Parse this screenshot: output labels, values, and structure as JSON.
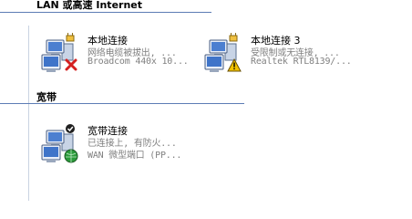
{
  "groups": {
    "lan_header": "LAN 或高速 Internet",
    "broadband_header": "宽带"
  },
  "connections": [
    {
      "name": "本地连接",
      "status": "网络电缆被拔出, ...",
      "device": "Broadcom 440x 10...",
      "overlay_icon": "red-x-icon"
    },
    {
      "name": "本地连接 3",
      "status": "受限制或无连接, ...",
      "device": "Realtek RTL8139/...",
      "overlay_icon": "warning-icon"
    },
    {
      "name": "宽带连接",
      "status": "已连接上, 有防火...",
      "device": "WAN 微型端口 (PP...",
      "overlay_icon": "globe-icon"
    }
  ],
  "colors": {
    "header_rule": "#5d7db5",
    "secondary_text": "#808080",
    "error_red": "#d42020",
    "warning_yellow": "#f2c200",
    "globe_green": "#2a9a3a"
  }
}
